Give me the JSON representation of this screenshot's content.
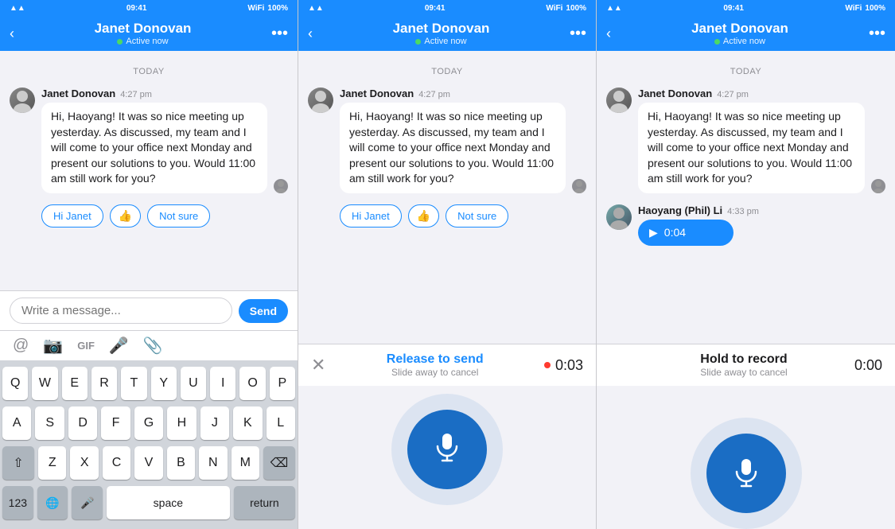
{
  "panels": [
    {
      "id": "panel1",
      "statusBar": {
        "time": "09:41",
        "signal": "WiFi",
        "carrier": "▲▲",
        "battery": "100%"
      },
      "navBar": {
        "backLabel": "‹",
        "name": "Janet Donovan",
        "status": "Active now",
        "moreLabel": "•••"
      },
      "dateDivider": "TODAY",
      "messages": [
        {
          "sender": "Janet Donovan",
          "time": "4:27 pm",
          "text": "Hi, Haoyang! It was so nice meeting up yesterday. As discussed, my team and I will come to your office next Monday and present our solutions to you. Would 11:00 am still work for you?"
        }
      ],
      "quickReplies": [
        "Hi Janet",
        "👍",
        "Not sure"
      ],
      "inputPlaceholder": "Write a message...",
      "sendLabel": "Send",
      "toolbarIcons": [
        "@",
        "📷",
        "GIF",
        "🎤",
        "📎"
      ]
    },
    {
      "id": "panel2",
      "statusBar": {
        "time": "09:41",
        "signal": "WiFi",
        "battery": "100%"
      },
      "navBar": {
        "backLabel": "‹",
        "name": "Janet Donovan",
        "status": "Active now",
        "moreLabel": "•••"
      },
      "dateDivider": "TODAY",
      "messages": [
        {
          "sender": "Janet Donovan",
          "time": "4:27 pm",
          "text": "Hi, Haoyang! It was so nice meeting up yesterday. As discussed, my team and I will come to your office next Monday and present our solutions to you. Would 11:00 am still work for you?"
        }
      ],
      "quickReplies": [
        "Hi Janet",
        "👍",
        "Not sure"
      ],
      "recordingLabel": "Release to send",
      "recordingSubLabel": "Slide away to cancel",
      "recordingTime": "0:03"
    },
    {
      "id": "panel3",
      "statusBar": {
        "time": "09:41",
        "signal": "WiFi",
        "battery": "100%"
      },
      "navBar": {
        "backLabel": "‹",
        "name": "Janet Donovan",
        "status": "Active now",
        "moreLabel": "•••"
      },
      "dateDivider": "TODAY",
      "messages": [
        {
          "sender": "Janet Donovan",
          "time": "4:27 pm",
          "text": "Hi, Haoyang! It was so nice meeting up yesterday. As discussed, my team and I will come to your office next Monday and present our solutions to you. Would 11:00 am still work for you?"
        },
        {
          "sender": "Haoyang (Phil) Li",
          "time": "4:33 pm",
          "isAudio": true,
          "audioDuration": "0:04"
        }
      ],
      "holdLabel": "Hold to record",
      "holdSubLabel": "Slide away to cancel",
      "holdTime": "0:00"
    }
  ],
  "keyboard": {
    "rows": [
      [
        "Q",
        "W",
        "E",
        "R",
        "T",
        "Y",
        "U",
        "I",
        "O",
        "P"
      ],
      [
        "A",
        "S",
        "D",
        "F",
        "G",
        "H",
        "J",
        "K",
        "L"
      ],
      [
        "⇧",
        "Z",
        "X",
        "C",
        "V",
        "B",
        "N",
        "M",
        "⌫"
      ],
      [
        "123",
        "🌐",
        "🎤",
        "space",
        "return"
      ]
    ]
  }
}
